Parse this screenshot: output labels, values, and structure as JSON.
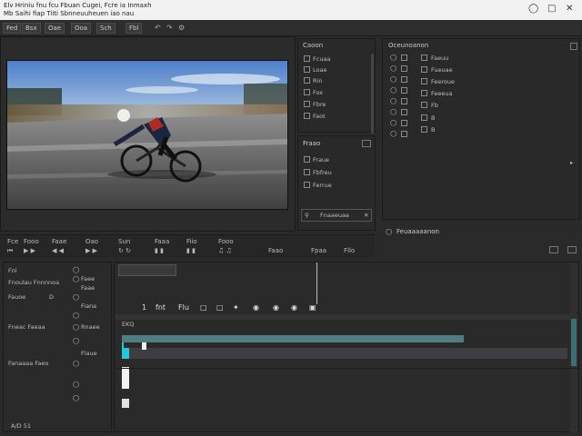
{
  "window": {
    "title_line1": "Elv Hriniu fnu fcu Fbuan Cugei, Fcre ia Inmaxh",
    "title_line2": "Mb Saihi fiap Tiiti Sbnneuuheuen iao nau"
  },
  "menubar": {
    "items": [
      "Fed",
      "Bsx",
      "Oae",
      "Ooa",
      "Sch",
      "Fbl"
    ]
  },
  "source_panel": {
    "title": "Caoon",
    "items": [
      "Fcuaa",
      "Loae",
      "Rin",
      "Fox",
      "Fbre",
      "Faot"
    ]
  },
  "effects_panel": {
    "title": "Fraao",
    "items": [
      "Fraue",
      "Fbfreu",
      "Ferrue"
    ],
    "footer": "Fnaaeuaa"
  },
  "project_panel": {
    "title": "Oceunoanon",
    "items": [
      "Faeuu",
      "Fueuae",
      "Feeroue",
      "Feeeua",
      "Fb",
      "B",
      "B"
    ]
  },
  "inspector": {
    "title": "Feuaaaaanon"
  },
  "transport": {
    "items": [
      "Fce",
      "Fooo",
      "Faae",
      "Oao",
      "Sun",
      "Faaa",
      "Fiio",
      "Fooo",
      "Faao",
      "Fpaa",
      "Fllo",
      "Faa"
    ]
  },
  "media_browser": {
    "title": "Fnl",
    "subtitle": "Fnoulau Fnnnnoa",
    "rows": [
      "Faee",
      "Faae",
      "Fiana",
      "Rnaee",
      "Flaue"
    ],
    "left_items": [
      "Fauoe",
      "D",
      "Fneac Faeaa",
      "Fanaaaa Faeo"
    ],
    "status": "A/D 51"
  },
  "timeline": {
    "track_label": "EKQ",
    "toolbar": [
      "1",
      "fnt",
      "Flu"
    ],
    "accent_track": "#4e7d82",
    "accent_cyan": "#23c8d6"
  }
}
